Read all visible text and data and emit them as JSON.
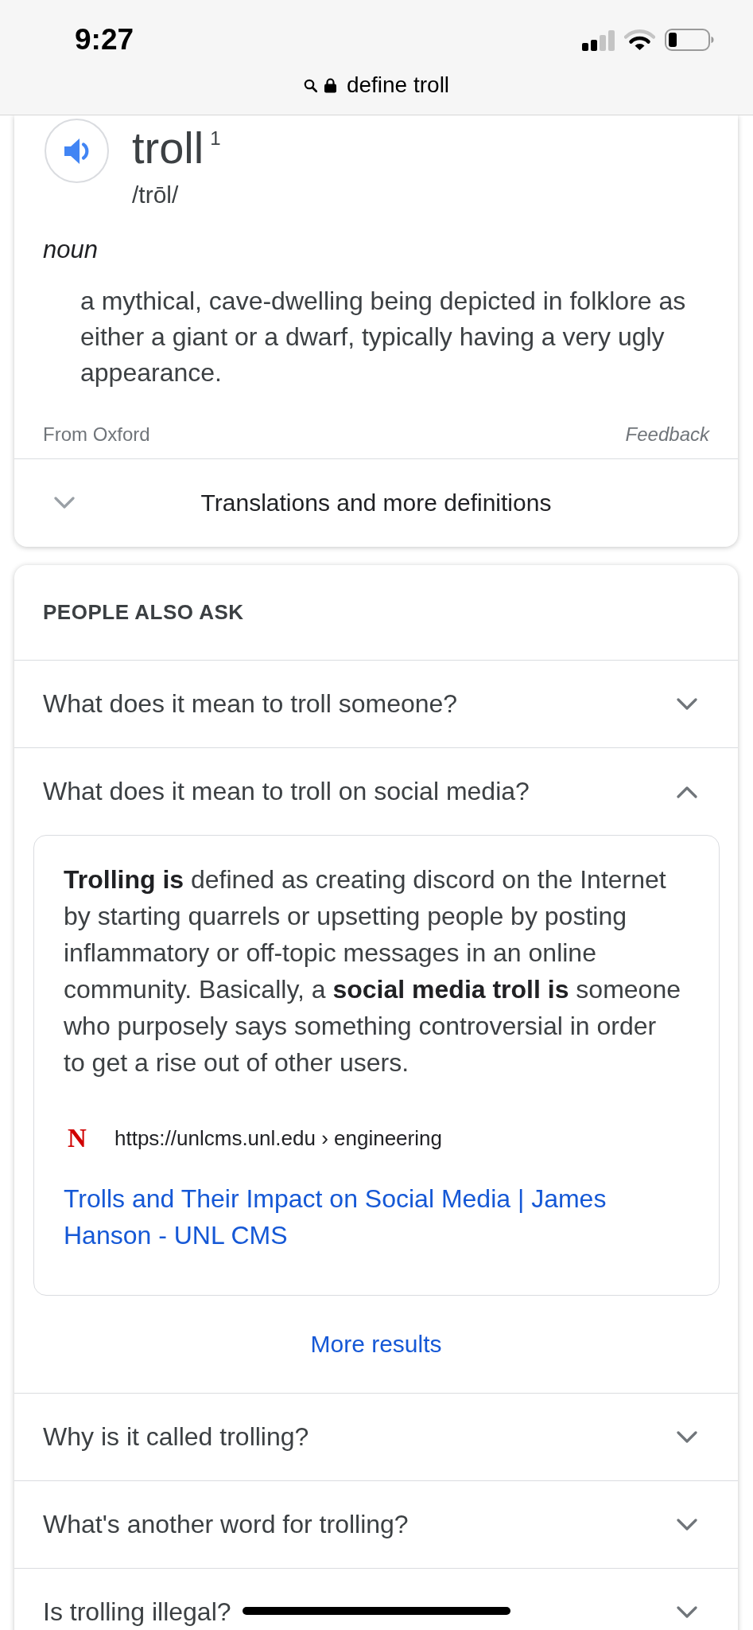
{
  "status_bar": {
    "time": "9:27"
  },
  "address_bar": {
    "text": "define troll"
  },
  "dictionary": {
    "word": "troll",
    "homograph": "1",
    "pronunciation": "/trōl/",
    "part_of_speech": "noun",
    "definition": "a mythical, cave-dwelling being depicted in folklore as either a giant or a dwarf, typically having a very ugly appearance.",
    "source": "From Oxford",
    "feedback": "Feedback",
    "more": {
      "label": "Translations and more definitions",
      "expanded": false
    }
  },
  "people_also_ask": {
    "title": "PEOPLE ALSO ASK",
    "questions": [
      {
        "text": "What does it mean to troll someone?",
        "expanded": false
      },
      {
        "text": "What does it mean to troll on social media?",
        "expanded": true,
        "answer": {
          "text": "**Trolling is** defined as creating discord on the Internet by starting quarrels or upsetting people by posting inflammatory or off-topic messages in an online community. Basically, a **social media troll is** someone who purposely says something controversial in order to get a rise out of other users.",
          "site_logo": "N",
          "source": "https://unlcms.unl.edu › engineering",
          "title": "Trolls and Their Impact on Social Media | James Hanson - UNL CMS",
          "more": "More results"
        }
      },
      {
        "text": "Why is it called trolling?",
        "expanded": false
      },
      {
        "text": "What's another word for trolling?",
        "expanded": false
      },
      {
        "text": "Is trolling illegal?",
        "expanded": false
      }
    ]
  }
}
